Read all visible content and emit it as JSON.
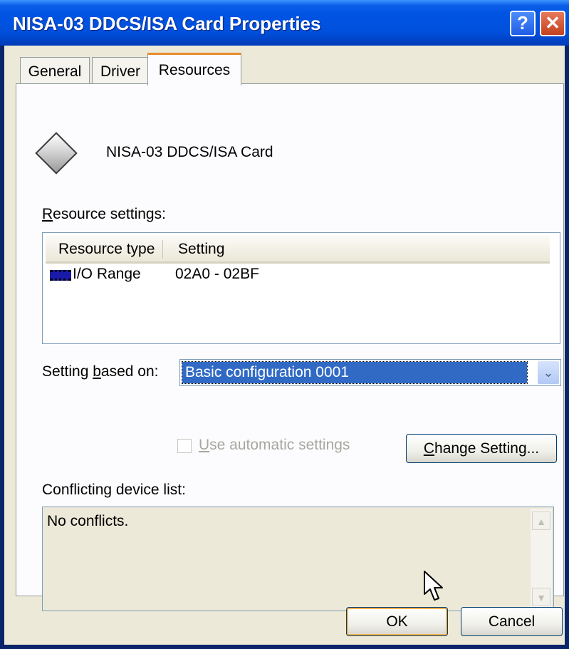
{
  "window": {
    "title": "NISA-03 DDCS/ISA Card Properties",
    "help_glyph": "?",
    "close_glyph": "✕"
  },
  "tabs": [
    {
      "label": "General",
      "active": false
    },
    {
      "label": "Driver",
      "active": false
    },
    {
      "label": "Resources",
      "active": true
    }
  ],
  "device": {
    "icon": "diamond-device-icon",
    "name": "NISA-03 DDCS/ISA Card"
  },
  "resource_settings": {
    "label_underlined": "R",
    "label_rest": "esource settings:",
    "columns": [
      "Resource type",
      "Setting"
    ],
    "rows": [
      {
        "icon": "io-range-icon",
        "type": "I/O Range",
        "setting": "02A0 - 02BF"
      }
    ]
  },
  "setting_based_on": {
    "label_prefix": "Setting ",
    "label_underlined": "b",
    "label_rest": "ased on:",
    "value": "Basic configuration 0001",
    "arrow_glyph": "⌄"
  },
  "auto_settings": {
    "label_underlined": "U",
    "label_rest": "se automatic settings",
    "checked": false,
    "enabled": false
  },
  "change_setting": {
    "label_underlined": "C",
    "label_rest": "hange Setting..."
  },
  "conflicts": {
    "label": "Conflicting device list:",
    "text": "No conflicts.",
    "scroll_up_glyph": "▲",
    "scroll_down_glyph": "▼"
  },
  "buttons": {
    "ok": "OK",
    "cancel": "Cancel"
  },
  "colors": {
    "titlebar": "#0054e3",
    "selection": "#316ac5",
    "dialog_bg": "#ece9d8",
    "active_tab_accent": "#e68b2c"
  }
}
